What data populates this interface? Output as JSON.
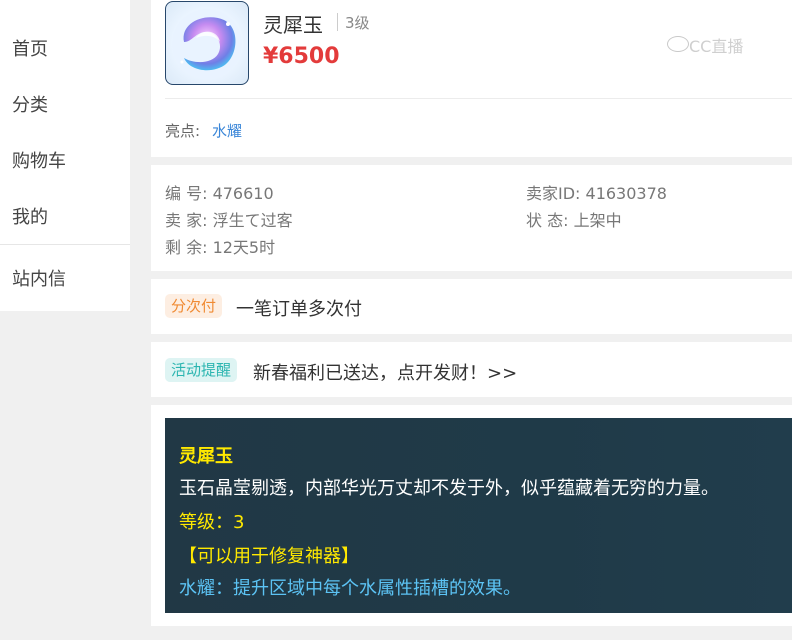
{
  "sidebar": {
    "items": [
      {
        "label": "首页"
      },
      {
        "label": "分类"
      },
      {
        "label": "购物车"
      },
      {
        "label": "我的"
      },
      {
        "label": "站内信"
      }
    ]
  },
  "product": {
    "name": "灵犀玉",
    "level": "3级",
    "price": "¥6500",
    "watermark": "CC直播",
    "highlight_label": "亮点:",
    "highlight_value": "水耀",
    "image_icon": "jade-gem-icon"
  },
  "info": {
    "id": "编 号: 476610",
    "seller_id": "卖家ID: 41630378",
    "seller": "卖 家: 浮生て过客",
    "status": "状 态: 上架中",
    "remaining": "剩 余: 12天5时"
  },
  "payment": {
    "tag": "分次付",
    "text": "一笔订单多次付"
  },
  "event": {
    "tag": "活动提醒",
    "text": "新春福利已送达，点开发财！>>"
  },
  "description": {
    "title": "灵犀玉",
    "text": "玉石晶莹剔透，内部华光万丈却不发于外，似乎蕴藏着无穷的力量。",
    "level": "等级：3",
    "usage": "【可以用于修复神器】",
    "effect": "水耀：提升区域中每个水属性插槽的效果。"
  },
  "colors": {
    "price": "#e33b3b",
    "link": "#3a86d8",
    "desc_bg": "#213845",
    "desc_yellow": "#ffe900",
    "desc_blue": "#5cc3f4",
    "tag_pay_bg": "#fdeee2",
    "tag_pay_text": "#f08a32",
    "tag_event_bg": "#def4f3",
    "tag_event_text": "#2bb5b0"
  }
}
